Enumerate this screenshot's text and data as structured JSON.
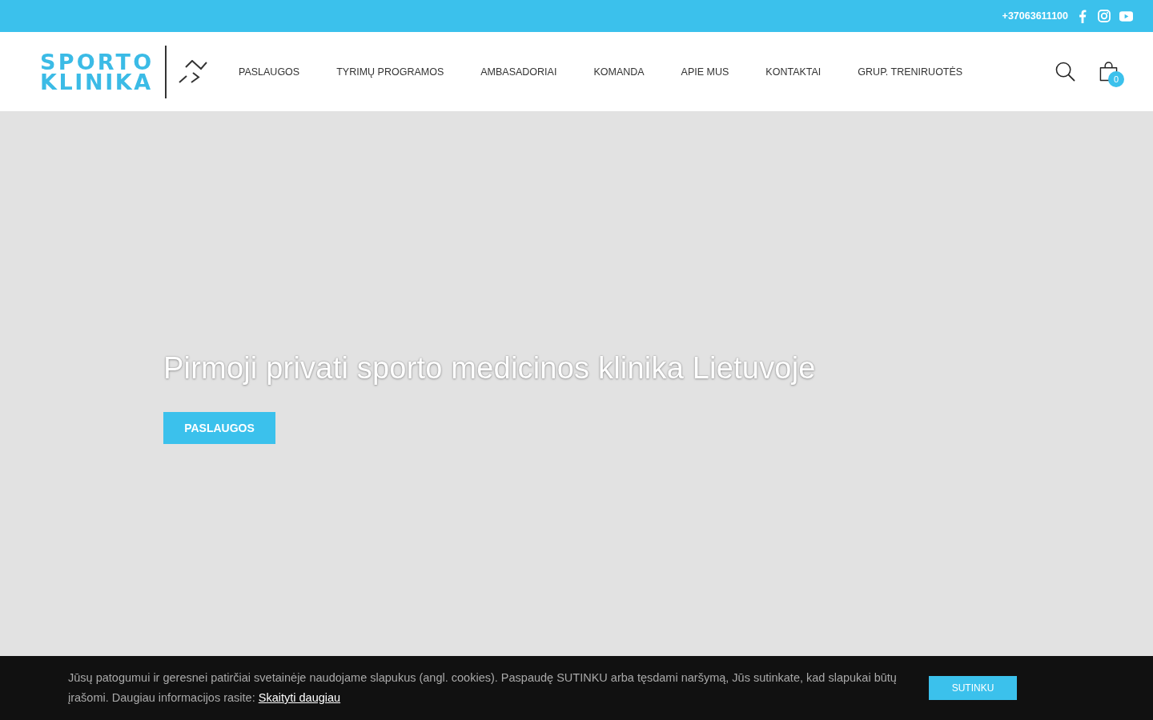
{
  "top_bar": {
    "phone": "+37063611100"
  },
  "header": {
    "logo": {
      "line_1": "SPORTO",
      "line_2": "KLINIKA"
    },
    "nav": [
      "PASLAUGOS",
      "TYRIMŲ PROGRAMOS",
      "AMBASADORIAI",
      "KOMANDA",
      "APIE MUS",
      "KONTAKTAI",
      "GRUP. TRENIRUOTĖS"
    ],
    "cart_count": "0"
  },
  "hero": {
    "title": "Pirmoji privati sporto medicinos klinika Lietuvoje",
    "button": "PASLAUGOS"
  },
  "cookie_bar": {
    "text": "Jūsų patogumui ir geresnei patirčiai svetainėje naudojame slapukus (angl. cookies). Paspaudę SUTINKU arba tęsdami naršymą, Jūs sutinkate, kad slapukai būtų įrašomi. Daugiau informacijos rasite: ",
    "link": "Skaityti daugiau",
    "button": "SUTINKU"
  }
}
